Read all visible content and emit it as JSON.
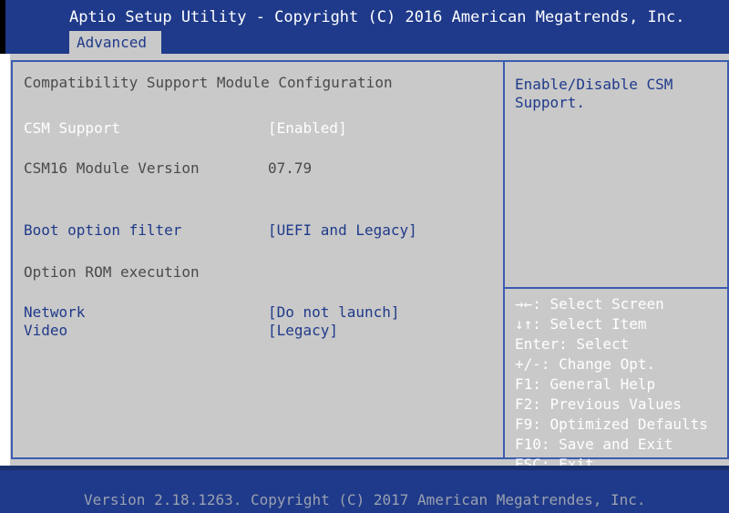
{
  "header": {
    "title": "Aptio Setup Utility - Copyright (C) 2016 American Megatrends, Inc.",
    "active_tab": "Advanced"
  },
  "main": {
    "section_title": "Compatibility Support Module Configuration",
    "csm_support": {
      "label": "CSM Support",
      "value": "[Enabled]"
    },
    "csm16_version": {
      "label": "CSM16 Module Version",
      "value": "07.79"
    },
    "boot_option_filter": {
      "label": "Boot option filter",
      "value": "[UEFI and Legacy]"
    },
    "option_rom_heading": "Option ROM execution",
    "network": {
      "label": "Network",
      "value": "[Do not launch]"
    },
    "video": {
      "label": "Video",
      "value": "[Legacy]"
    }
  },
  "help": {
    "text": "Enable/Disable CSM Support."
  },
  "keys": [
    "→←: Select Screen",
    "↓↑: Select Item",
    "Enter: Select",
    "+/-: Change Opt.",
    "F1: General Help",
    "F2: Previous Values",
    "F9: Optimized Defaults",
    "F10: Save and Exit",
    "ESC: Exit"
  ],
  "footer": {
    "version": "Version 2.18.1263. Copyright (C) 2017 American Megatrendes, Inc."
  },
  "colors": {
    "header_bg": "#1f3a8a",
    "panel_bg": "#c9c9c9",
    "accent_blue": "#1f3a8a",
    "selected_white": "#ffffff",
    "static_gray": "#4a4a4a"
  }
}
